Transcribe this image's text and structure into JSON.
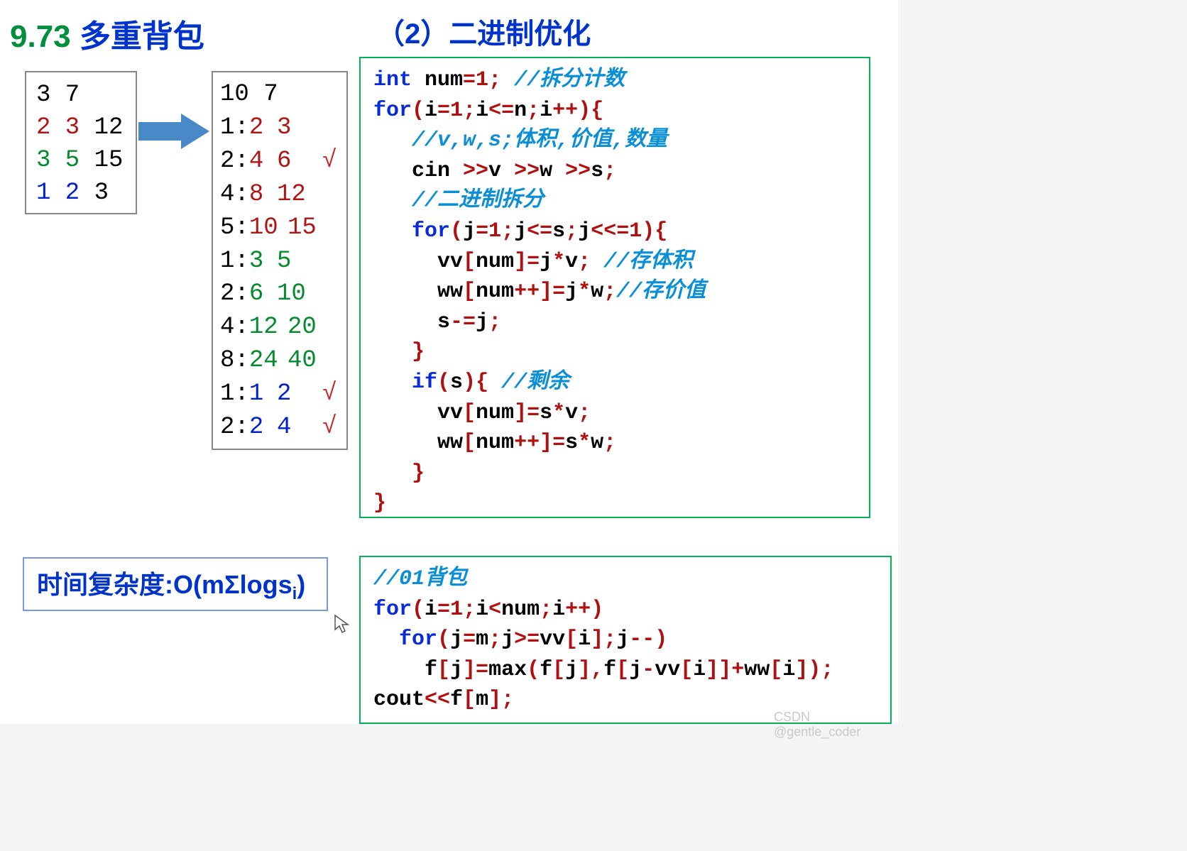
{
  "title": {
    "section_no": "9.73",
    "section_name_cn": "多重背包",
    "right_label": "（2）二进制优化"
  },
  "input_box": {
    "header": "3 7",
    "rows": [
      {
        "v": "2",
        "w": "3",
        "s": "12",
        "color": "red"
      },
      {
        "v": "3",
        "w": "5",
        "s": "15",
        "color": "green"
      },
      {
        "v": "1",
        "w": "2",
        "s": "3",
        "color": "blue"
      }
    ]
  },
  "output_box": {
    "header": "10 7",
    "rows": [
      {
        "k": "1",
        "vol": "2",
        "val": "3",
        "color": "red",
        "check": false
      },
      {
        "k": "2",
        "vol": "4",
        "val": "6",
        "color": "red",
        "check": true
      },
      {
        "k": "4",
        "vol": "8",
        "val": "12",
        "color": "red",
        "check": false
      },
      {
        "k": "5",
        "vol": "10",
        "val": "15",
        "color": "red",
        "check": false
      },
      {
        "k": "1",
        "vol": "3",
        "val": "5",
        "color": "green",
        "check": false
      },
      {
        "k": "2",
        "vol": "6",
        "val": "10",
        "color": "green",
        "check": false
      },
      {
        "k": "4",
        "vol": "12",
        "val": "20",
        "color": "green",
        "check": false
      },
      {
        "k": "8",
        "vol": "24",
        "val": "40",
        "color": "green",
        "check": false
      },
      {
        "k": "1",
        "vol": "1",
        "val": "2",
        "color": "blue",
        "check": true
      },
      {
        "k": "2",
        "vol": "2",
        "val": "4",
        "color": "blue",
        "check": true
      }
    ]
  },
  "complexity": {
    "prefix": "时间复杂度:O(mΣlogs",
    "sub": "i",
    "suffix": ")"
  },
  "code1": {
    "l1_kw": "int",
    "l1_a": " num",
    "l1_eq": "=",
    "l1_n": "1",
    "l1_sc": ";",
    "l1_cm": " //拆分计数",
    "l2_kw": "for",
    "l2_a": "(",
    "l2_b": "i",
    "l2_eq1": "=",
    "l2_n1": "1",
    "l2_sc1": ";",
    "l2_c": "i",
    "l2_op": "<=",
    "l2_d": "n",
    "l2_sc2": ";",
    "l2_e": "i",
    "l2_pp": "++",
    "l2_f": "){",
    "l3_cm": "   //v,w,s;体积,价值,数量",
    "l4_a": "   cin ",
    "l4_op1": ">>",
    "l4_b": "v ",
    "l4_op2": ">>",
    "l4_c": "w ",
    "l4_op3": ">>",
    "l4_d": "s",
    "l4_sc": ";",
    "l5_cm": "   //二进制拆分",
    "l6_sp": "   ",
    "l6_kw": "for",
    "l6_a": "(",
    "l6_b": "j",
    "l6_eq": "=",
    "l6_n": "1",
    "l6_sc1": ";",
    "l6_c": "j",
    "l6_op": "<=",
    "l6_d": "s",
    "l6_sc2": ";",
    "l6_e": "j",
    "l6_sh": "<<=",
    "l6_n2": "1",
    "l6_f": "){",
    "l7_a": "     vv",
    "l7_br1": "[",
    "l7_b": "num",
    "l7_br2": "]=",
    "l7_c": "j",
    "l7_st": "*",
    "l7_d": "v",
    "l7_sc": ";",
    "l7_cm": " //存体积",
    "l8_a": "     ww",
    "l8_br1": "[",
    "l8_b": "num",
    "l8_pp": "++",
    "l8_br2": "]=",
    "l8_c": "j",
    "l8_st": "*",
    "l8_d": "w",
    "l8_sc": ";",
    "l8_cm": "//存价值",
    "l9_a": "     s",
    "l9_op": "-=",
    "l9_b": "j",
    "l9_sc": ";",
    "l10": "   }",
    "l11_sp": "   ",
    "l11_kw": "if",
    "l11_a": "(",
    "l11_b": "s",
    "l11_c": "){",
    "l11_cm": " //剩余",
    "l12_a": "     vv",
    "l12_br1": "[",
    "l12_b": "num",
    "l12_br2": "]=",
    "l12_c": "s",
    "l12_st": "*",
    "l12_d": "v",
    "l12_sc": ";",
    "l13_a": "     ww",
    "l13_br1": "[",
    "l13_b": "num",
    "l13_pp": "++",
    "l13_br2": "]=",
    "l13_c": "s",
    "l13_st": "*",
    "l13_d": "w",
    "l13_sc": ";",
    "l14": "   }",
    "l15": "}"
  },
  "code2": {
    "l1_cm": "//01背包",
    "l2_kw": "for",
    "l2_a": "(",
    "l2_b": "i",
    "l2_eq": "=",
    "l2_n": "1",
    "l2_sc1": ";",
    "l2_c": "i",
    "l2_op": "<",
    "l2_d": "num",
    "l2_sc2": ";",
    "l2_e": "i",
    "l2_pp": "++",
    "l2_f": ")",
    "l3_sp": "  ",
    "l3_kw": "for",
    "l3_a": "(",
    "l3_b": "j",
    "l3_eq": "=",
    "l3_c": "m",
    "l3_sc1": ";",
    "l3_d": "j",
    "l3_op": ">=",
    "l3_e": "vv",
    "l3_br1": "[",
    "l3_f": "i",
    "l3_br2": "];",
    "l3_g": "j",
    "l3_mm": "--",
    "l3_h": ")",
    "l4_a": "    f",
    "l4_br1": "[",
    "l4_b": "j",
    "l4_br2": "]=",
    "l4_c": "max",
    "l4_p1": "(",
    "l4_d": "f",
    "l4_br3": "[",
    "l4_e": "j",
    "l4_br4": "],",
    "l4_f": "f",
    "l4_br5": "[",
    "l4_g": "j",
    "l4_mn": "-",
    "l4_h": "vv",
    "l4_br6": "[",
    "l4_i": "i",
    "l4_br7": "]]+",
    "l4_j": "ww",
    "l4_br8": "[",
    "l4_k": "i",
    "l4_br9": "]);",
    "l5_a": "cout",
    "l5_op": "<<",
    "l5_b": "f",
    "l5_br1": "[",
    "l5_c": "m",
    "l5_br2": "];"
  },
  "watermark": "CSDN @gentle_coder"
}
